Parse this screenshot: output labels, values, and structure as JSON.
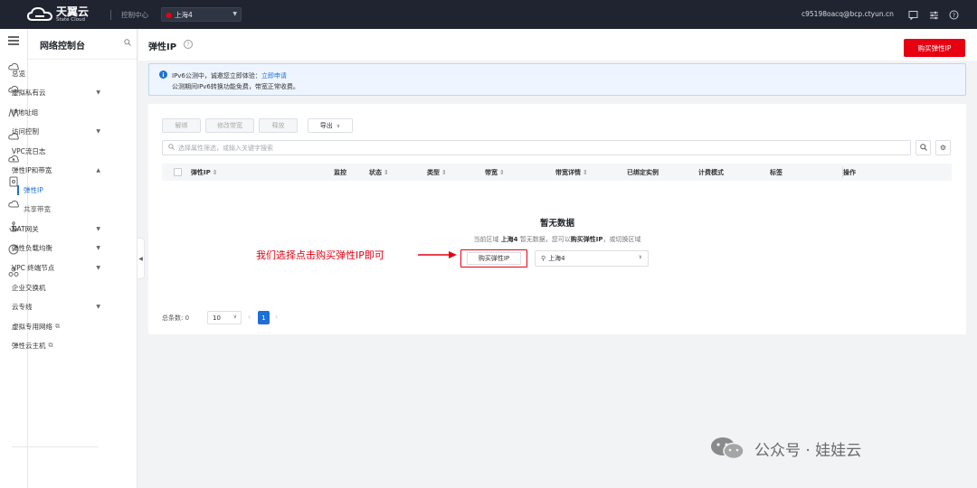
{
  "topbar": {
    "logo_cn": "天翼云",
    "logo_en": "State Cloud",
    "console_label": "控制中心",
    "region": "上海4",
    "user_email": "c95198oacq@bcp.ctyun.cn"
  },
  "sidebar": {
    "title": "网络控制台",
    "items": [
      {
        "label": "总览"
      },
      {
        "label": "虚拟私有云"
      },
      {
        "label": "IP地址组"
      },
      {
        "label": "访问控制"
      },
      {
        "label": "VPC流日志"
      },
      {
        "label": "弹性IP和带宽"
      },
      {
        "label": "弹性IP"
      },
      {
        "label": "共享带宽"
      },
      {
        "label": "NAT网关"
      },
      {
        "label": "弹性负载均衡"
      },
      {
        "label": "VPC 终端节点"
      },
      {
        "label": "企业交换机"
      },
      {
        "label": "云专线"
      },
      {
        "label": "虚拟专用网络"
      },
      {
        "label": "弹性云主机"
      }
    ]
  },
  "header": {
    "title": "弹性IP",
    "buy_label": "购买弹性IP"
  },
  "notice": {
    "line1_text": "IPv6公测中，诚邀您立即体验：",
    "line1_link": "立即申请",
    "line2": "公测期间IPv6转换功能免费，带宽正常收费。"
  },
  "toolbar": {
    "unbind": "解绑",
    "modify_bw": "修改带宽",
    "release": "释放",
    "export": "导出"
  },
  "search": {
    "placeholder": "选择属性筛选，或输入关键字搜索"
  },
  "table": {
    "columns": [
      "弹性IP",
      "监控",
      "状态",
      "类型",
      "带宽",
      "带宽详情",
      "已绑定实例",
      "计费模式",
      "标签",
      "操作"
    ]
  },
  "empty": {
    "title": "暂无数据",
    "desc_prefix": "当前区域",
    "desc_region": "上海4",
    "desc_mid": "暂无数据，您可以",
    "desc_action": "购买弹性IP",
    "desc_suffix": "，或切换区域",
    "buy_label": "购买弹性IP",
    "region_value": "上海4"
  },
  "pagination": {
    "total_label": "总条数:",
    "total": "0",
    "page_size": "10",
    "current_page": "1"
  },
  "annotation": {
    "text": "我们选择点击购买弹性IP即可"
  },
  "watermark": {
    "text": "公众号 · 娃娃云"
  },
  "colors": {
    "brand_red": "#e60012",
    "link_blue": "#1f6fd6",
    "topbar_bg": "#1f2430"
  }
}
